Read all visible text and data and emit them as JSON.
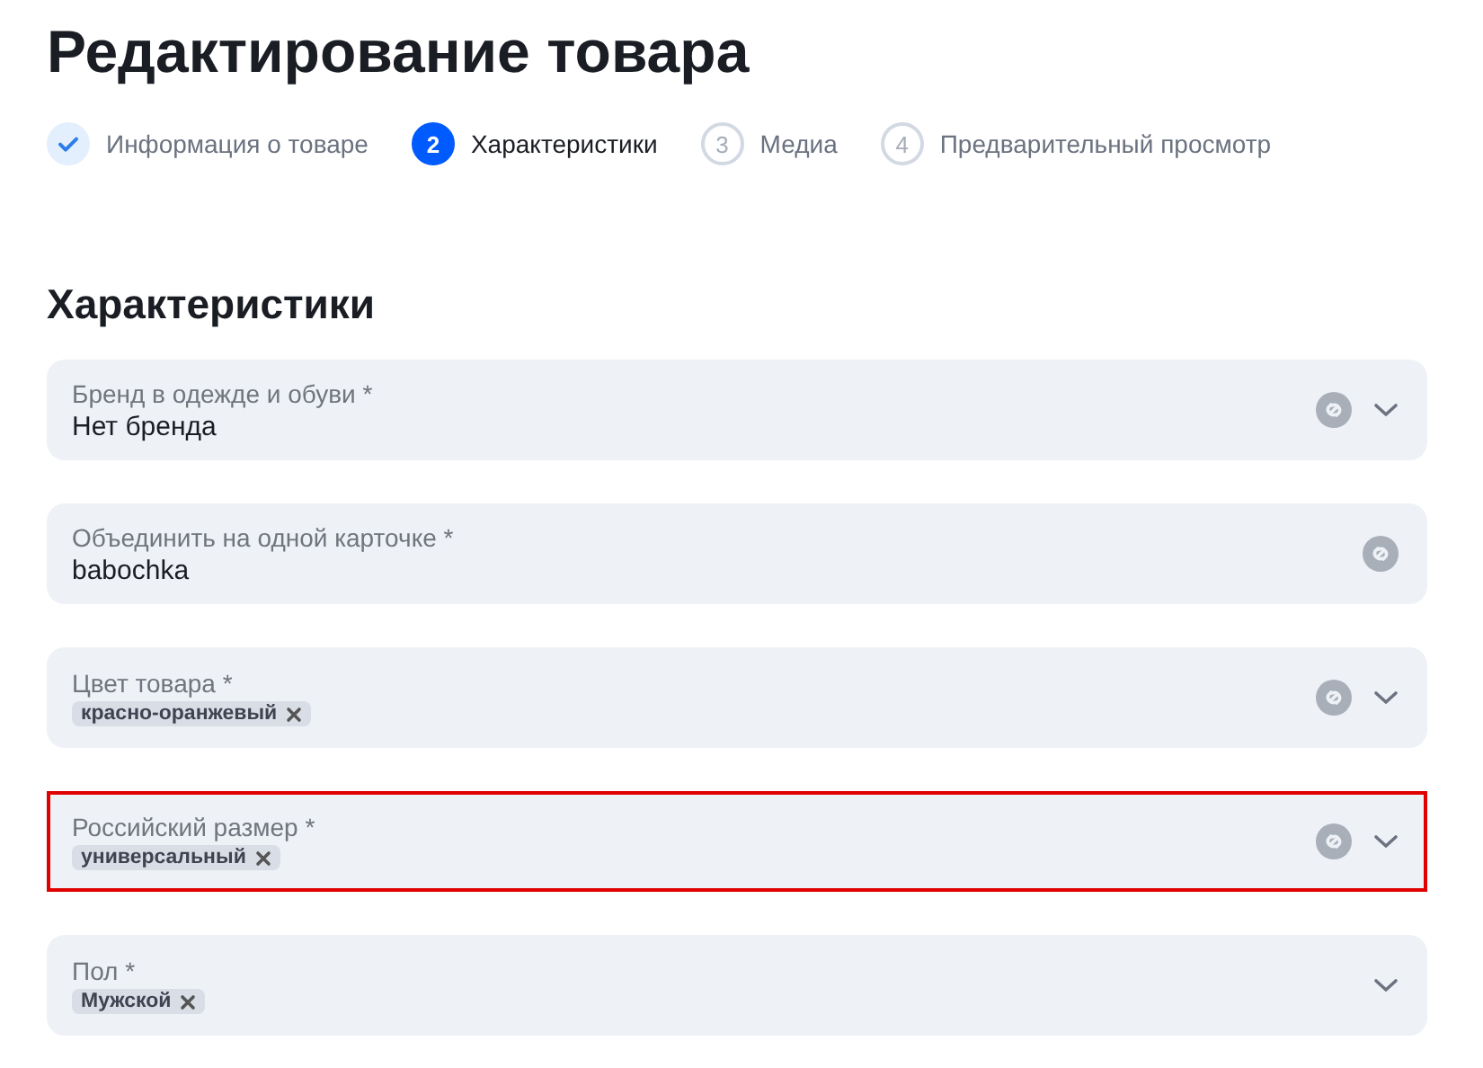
{
  "title": "Редактирование товара",
  "steps": [
    {
      "label": "Информация о товаре",
      "done": true,
      "selected": false
    },
    {
      "number": "2",
      "label": "Характеристики",
      "done": false,
      "selected": true
    },
    {
      "number": "3",
      "label": "Медиа",
      "done": false,
      "selected": false
    },
    {
      "number": "4",
      "label": "Предварительный просмотр",
      "done": false,
      "selected": false
    }
  ],
  "section_title": "Характеристики",
  "fields": [
    {
      "label": "Бренд в одежде и обуви *",
      "value": "Нет бренда",
      "linked": true,
      "dropdown": true,
      "highlighted": false
    },
    {
      "label": "Объединить на одной карточке *",
      "value": "babochka",
      "linked": true,
      "dropdown": false,
      "highlighted": false
    },
    {
      "label": "Цвет товара *",
      "tags": [
        "красно-оранжевый"
      ],
      "linked": true,
      "dropdown": true,
      "highlighted": false
    },
    {
      "label": "Российский размер *",
      "tags": [
        "универсальный"
      ],
      "linked": true,
      "dropdown": true,
      "highlighted": true
    },
    {
      "label": "Пол *",
      "tags": [
        "Мужской"
      ],
      "linked": false,
      "dropdown": true,
      "highlighted": false
    }
  ]
}
